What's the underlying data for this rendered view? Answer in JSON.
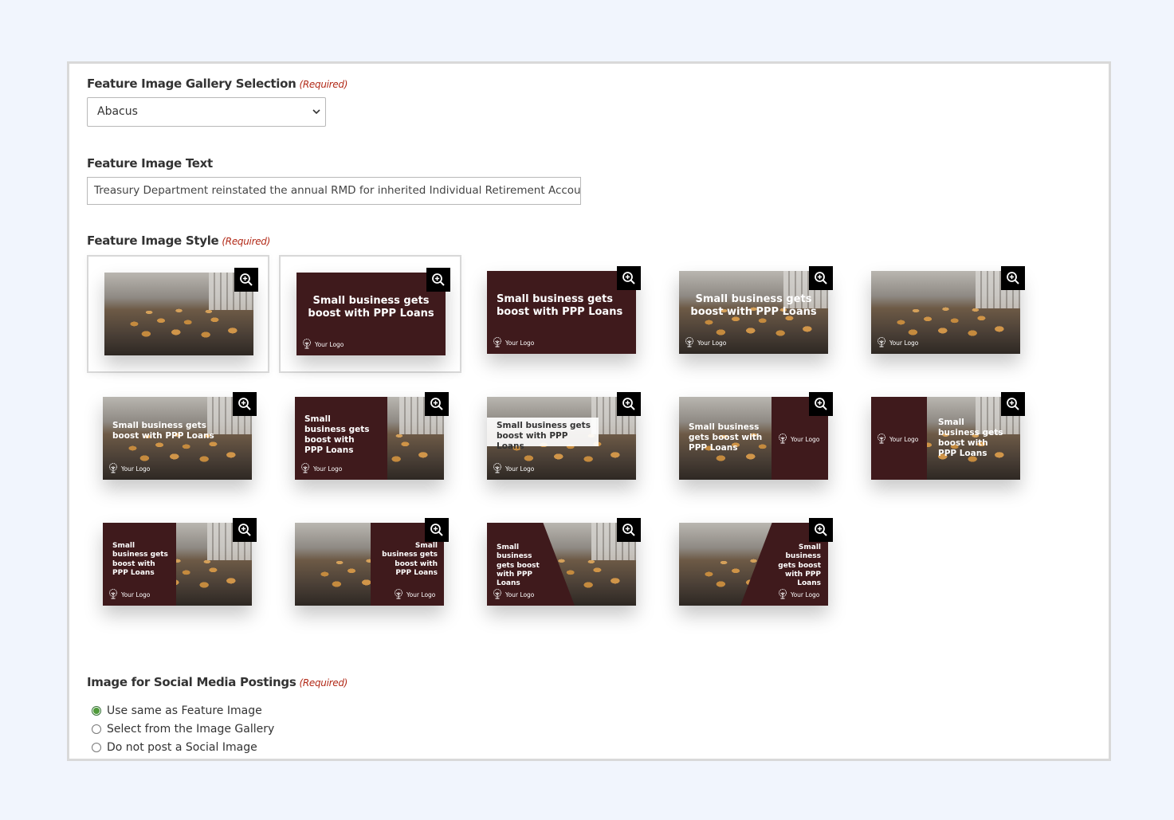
{
  "gallery": {
    "label": "Feature Image Gallery Selection",
    "required": "(Required)",
    "selected": "Abacus"
  },
  "text": {
    "label": "Feature Image Text",
    "value": "Treasury Department reinstated the annual RMD for inherited Individual Retirement Accounts"
  },
  "style": {
    "label": "Feature Image Style",
    "required": "(Required)",
    "headline": "Small business gets boost with PPP Loans",
    "logo": "Your Logo",
    "zoom_icon": "zoom-in-icon",
    "brand_color": "#3f1a1c"
  },
  "social": {
    "label": "Image for Social Media Postings",
    "required": "(Required)",
    "options": [
      {
        "label": "Use same as Feature Image",
        "checked": true
      },
      {
        "label": "Select from the Image Gallery",
        "checked": false
      },
      {
        "label": "Do not post a Social Image",
        "checked": false
      }
    ]
  }
}
